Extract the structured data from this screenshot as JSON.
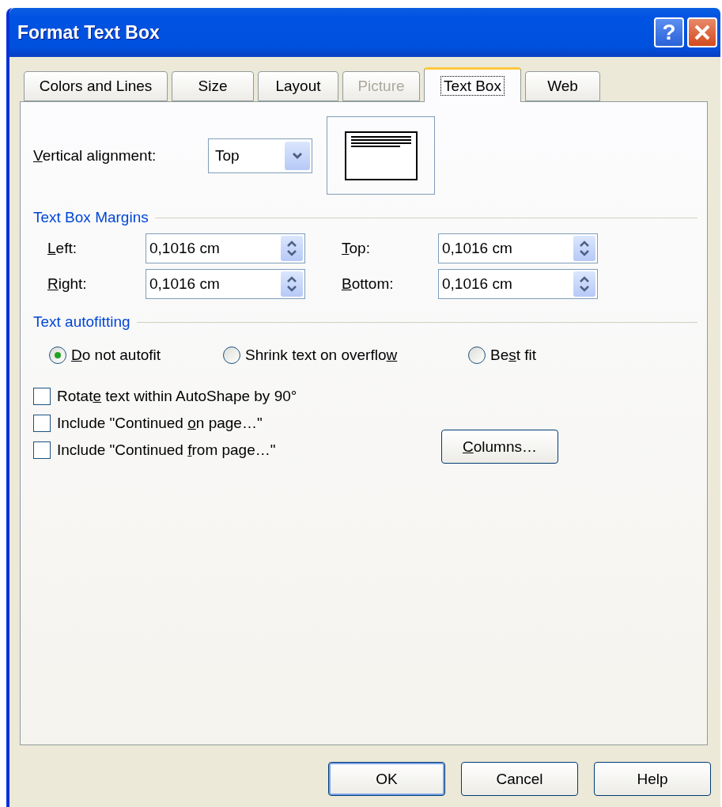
{
  "window": {
    "title": "Format Text Box",
    "help_button": "?"
  },
  "tabs": [
    {
      "label": "Colors and Lines",
      "selected": false,
      "disabled": false
    },
    {
      "label": "Size",
      "selected": false,
      "disabled": false
    },
    {
      "label": "Layout",
      "selected": false,
      "disabled": false
    },
    {
      "label": "Picture",
      "selected": false,
      "disabled": true
    },
    {
      "label": "Text Box",
      "selected": true,
      "disabled": false
    },
    {
      "label": "Web",
      "selected": false,
      "disabled": false
    }
  ],
  "vertical_alignment": {
    "label": {
      "key": "V",
      "post": "ertical alignment:"
    },
    "value": "Top"
  },
  "margins": {
    "title": "Text Box Margins",
    "fields": [
      {
        "label": {
          "key": "L",
          "post": "eft:"
        },
        "value": "0,1016 cm"
      },
      {
        "label": {
          "key": "T",
          "post": "op:"
        },
        "value": "0,1016 cm"
      },
      {
        "label": {
          "key": "R",
          "post": "ight:"
        },
        "value": "0,1016 cm"
      },
      {
        "label": {
          "key": "B",
          "post": "ottom:"
        },
        "value": "0,1016 cm"
      }
    ]
  },
  "autofitting": {
    "title": "Text autofitting",
    "options": [
      {
        "label": {
          "key": "D",
          "post": "o not autofit"
        },
        "selected": true
      },
      {
        "label": {
          "pre": "Shrink text on overflo",
          "key": "w"
        },
        "selected": false
      },
      {
        "label": {
          "pre": "Be",
          "key": "s",
          "post": "t fit"
        },
        "selected": false
      }
    ]
  },
  "checkboxes": [
    {
      "label": {
        "pre": "Rotat",
        "key": "e",
        "post": " text within AutoShape by 90°"
      },
      "checked": false
    },
    {
      "label": {
        "pre": "Include \"Continued ",
        "key": "o",
        "post": "n page…\""
      },
      "checked": false
    },
    {
      "label": {
        "pre": "Include \"Continued ",
        "key": "f",
        "post": "rom page…\""
      },
      "checked": false
    }
  ],
  "columns_button": {
    "key": "C",
    "post": "olumns…"
  },
  "buttons": [
    {
      "label": "OK",
      "default": true
    },
    {
      "label": "Cancel",
      "default": false
    },
    {
      "label": "Help",
      "default": false
    }
  ]
}
